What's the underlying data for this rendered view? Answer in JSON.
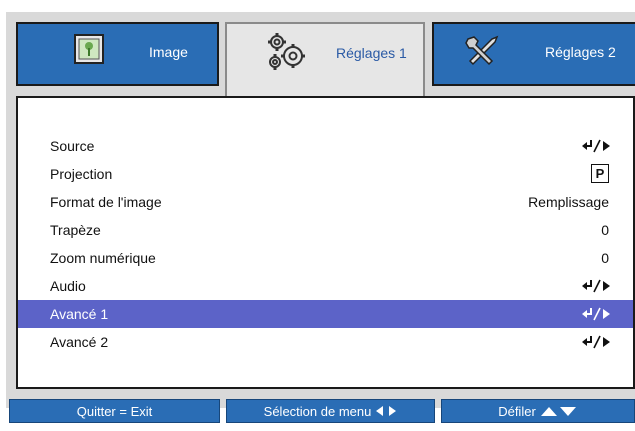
{
  "tabs": [
    {
      "label": "Image",
      "icon": "image-icon",
      "active": false
    },
    {
      "label": "Réglages 1",
      "icon": "gears-icon",
      "active": true
    },
    {
      "label": "Réglages 2",
      "icon": "tools-icon",
      "active": false
    }
  ],
  "menu": {
    "items": [
      {
        "label": "Source",
        "value": "",
        "indicator": "enter-arrow-icon"
      },
      {
        "label": "Projection",
        "value": "P",
        "indicator": "projection-icon"
      },
      {
        "label": "Format de l'image",
        "value": "Remplissage",
        "indicator": ""
      },
      {
        "label": "Trapèze",
        "value": "0",
        "indicator": ""
      },
      {
        "label": "Zoom numérique",
        "value": "0",
        "indicator": ""
      },
      {
        "label": "Audio",
        "value": "",
        "indicator": "enter-arrow-icon"
      },
      {
        "label": "Avancé 1",
        "value": "",
        "indicator": "enter-arrow-icon",
        "selected": true
      },
      {
        "label": "Avancé 2",
        "value": "",
        "indicator": "enter-arrow-icon"
      }
    ]
  },
  "footer": {
    "quit": "Quitter = Exit",
    "menu_select": "Sélection de menu",
    "scroll": "Défiler"
  },
  "colors": {
    "tab_blue": "#2a6db5",
    "selection": "#5c63c8",
    "frame_gray": "#d9d9d9"
  }
}
